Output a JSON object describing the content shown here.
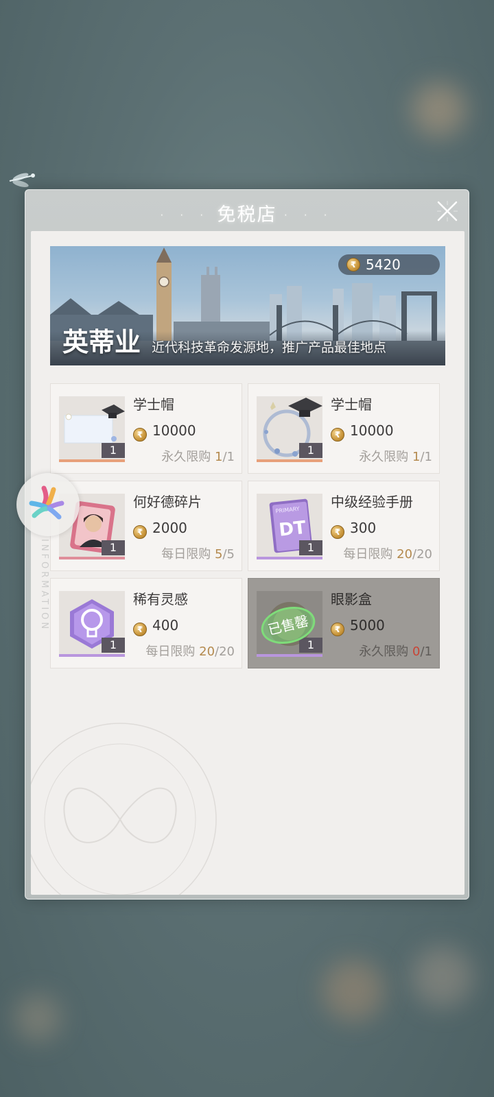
{
  "shop": {
    "title": "免税店",
    "balance": "5420"
  },
  "banner": {
    "location_name": "英蒂业",
    "description": "近代科技革命发源地，推广产品最佳地点"
  },
  "side_text": "INFORMATION",
  "items": [
    {
      "name": "学士帽",
      "price": "10000",
      "limit_label": "永久限购",
      "limit_current": "1",
      "limit_total": "/1",
      "qty": "1",
      "sold": false
    },
    {
      "name": "学士帽",
      "price": "10000",
      "limit_label": "永久限购",
      "limit_current": "1",
      "limit_total": "/1",
      "qty": "1",
      "sold": false
    },
    {
      "name": "何好德碎片",
      "price": "2000",
      "limit_label": "每日限购",
      "limit_current": "5",
      "limit_total": "/5",
      "qty": "1",
      "sold": false
    },
    {
      "name": "中级经验手册",
      "price": "300",
      "limit_label": "每日限购",
      "limit_current": "20",
      "limit_total": "/20",
      "qty": "1",
      "sold": false
    },
    {
      "name": "稀有灵感",
      "price": "400",
      "limit_label": "每日限购",
      "limit_current": "20",
      "limit_total": "/20",
      "qty": "1",
      "sold": false
    },
    {
      "name": "眼影盒",
      "price": "5000",
      "limit_label": "永久限购",
      "limit_current": "0",
      "limit_total": "/1",
      "qty": "1",
      "sold": true,
      "sold_label": "已售罄"
    }
  ],
  "thumb_art": {
    "manual_text": "DT",
    "manual_small": "PRIMARY"
  }
}
